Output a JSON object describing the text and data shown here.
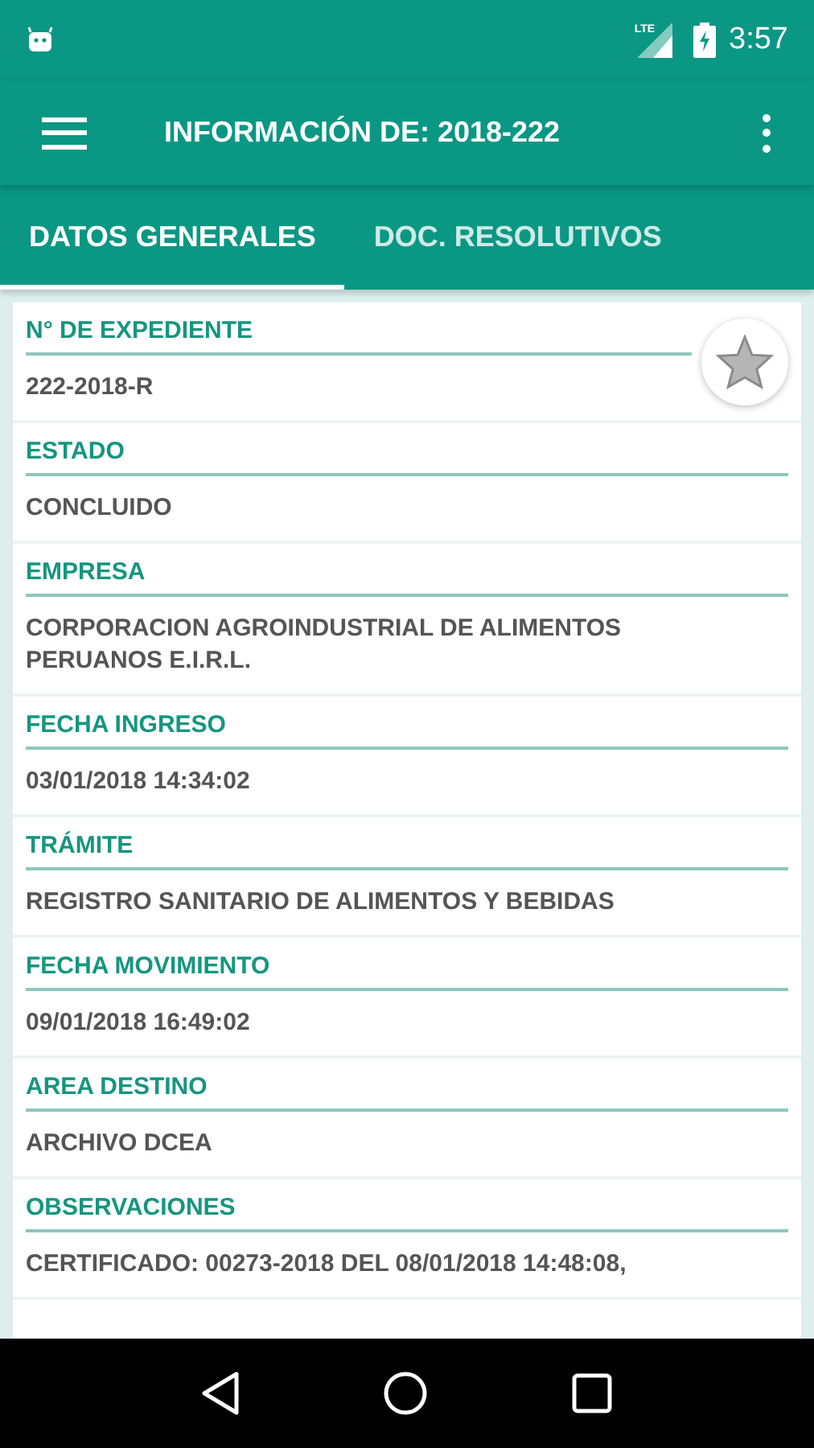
{
  "status_bar": {
    "time": "3:57",
    "network": "LTE"
  },
  "toolbar": {
    "title": "INFORMACIÓN DE: 2018-222"
  },
  "tabs": [
    {
      "label": "DATOS GENERALES",
      "selected": true
    },
    {
      "label": "DOC. RESOLUTIVOS",
      "selected": false
    }
  ],
  "favorite": {
    "starred": false
  },
  "fields": [
    {
      "label": "N° DE EXPEDIENTE",
      "value": "222-2018-R"
    },
    {
      "label": "ESTADO",
      "value": "CONCLUIDO"
    },
    {
      "label": "EMPRESA",
      "value": "CORPORACION AGROINDUSTRIAL DE ALIMENTOS PERUANOS E.I.R.L."
    },
    {
      "label": "FECHA INGRESO",
      "value": "03/01/2018 14:34:02"
    },
    {
      "label": "TRÁMITE",
      "value": "REGISTRO SANITARIO DE ALIMENTOS Y BEBIDAS"
    },
    {
      "label": "FECHA MOVIMIENTO",
      "value": "09/01/2018 16:49:02"
    },
    {
      "label": "AREA DESTINO",
      "value": "ARCHIVO DCEA"
    },
    {
      "label": "OBSERVACIONES",
      "value": "CERTIFICADO: 00273-2018 DEL 08/01/2018 14:48:08,"
    }
  ]
}
